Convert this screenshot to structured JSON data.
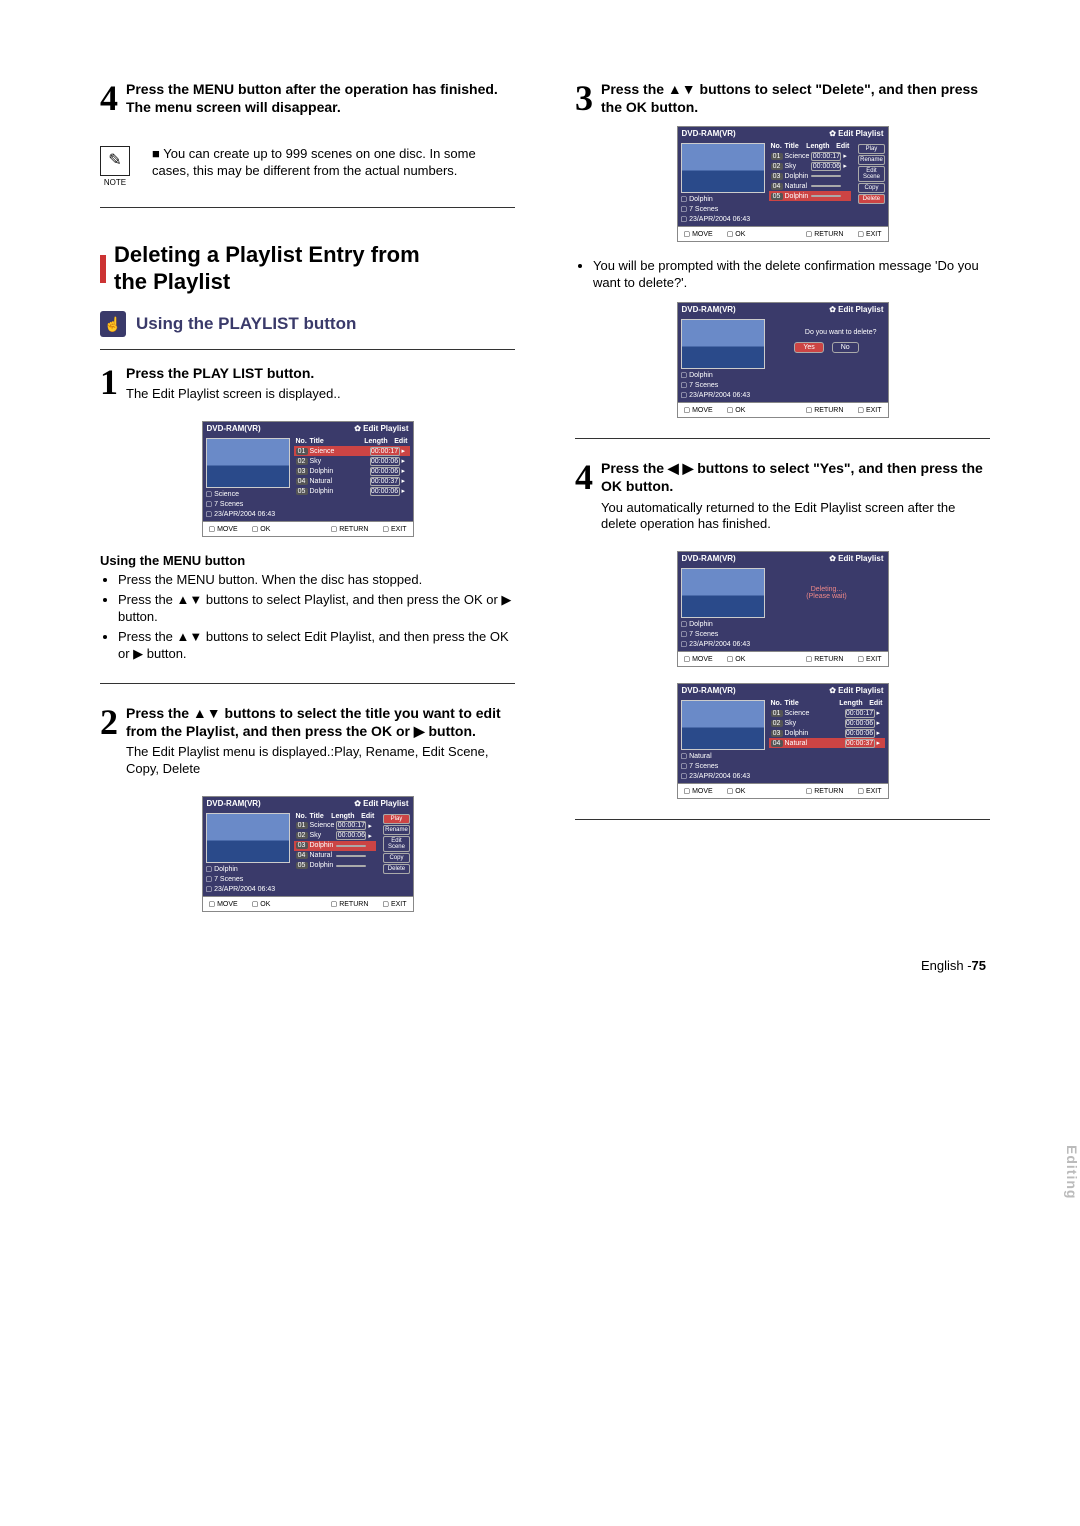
{
  "left": {
    "step4": {
      "num": "4",
      "text_a": "Press the MENU button after the operation has finished.",
      "text_b": "The menu screen will disappear."
    },
    "note": {
      "label": "NOTE",
      "bullet": "■",
      "text": "You can create up to 999 scenes on one disc. In some cases, this may be different from the actual numbers."
    },
    "h2_a": "Deleting a Playlist Entry from",
    "h2_b": "the Playlist",
    "sub_title": "Using the PLAYLIST button",
    "step1": {
      "num": "1",
      "title": "Press the PLAY LIST button.",
      "body": "The Edit Playlist screen is displayed.."
    },
    "menu_head": "Using the MENU button",
    "menu_b1": "Press the MENU button. When the disc has stopped.",
    "menu_b2": "Press the ▲▼ buttons to select Playlist, and then press the OK or ▶ button.",
    "menu_b3": "Press the ▲▼ buttons to select Edit Playlist, and then press the OK or ▶ button.",
    "step2": {
      "num": "2",
      "text": "Press the ▲▼ buttons to select the title you want to edit from the Playlist, and then press the OK or ▶ button.",
      "body": "The Edit Playlist menu is displayed.:Play, Rename, Edit Scene, Copy, Delete"
    }
  },
  "right": {
    "step3": {
      "num": "3",
      "text": "Press the ▲▼ buttons to select \"Delete\", and then press the OK button."
    },
    "confirm_body": "You will be prompted with the delete confirmation message 'Do you want to delete?'.",
    "step4r": {
      "num": "4",
      "text": "Press the ◀ ▶ buttons to select \"Yes\", and then press the OK button.",
      "body": "You automatically returned to the Edit Playlist screen after the delete operation has finished."
    }
  },
  "scr": {
    "disc": "DVD-RAM(VR)",
    "panel_label": "Edit Playlist",
    "no": "No.",
    "title": "Title",
    "length": "Length",
    "edit": "Edit",
    "titles_a": [
      "Science",
      "Sky",
      "Dolphin",
      "Natural",
      "Dolphin"
    ],
    "titles_b": [
      "Science",
      "Sky",
      "Dolphin",
      "Natural",
      "Dolphin"
    ],
    "titles_c": [
      "Science",
      "Sky",
      "Dolphin",
      "Natural"
    ],
    "lens_a": [
      "00:00:17",
      "00:00:06",
      "00:00:06",
      "00:00:37",
      "00:00:06"
    ],
    "lens_b": [
      "00:00:17",
      "00:00:06",
      "00:00:06",
      "00:00:37"
    ],
    "edit_menu": [
      "Play",
      "Rename",
      "Edit Scene",
      "Copy",
      "Delete"
    ],
    "info_title_a": "Science",
    "info_title_b": "Dolphin",
    "info_title_c": "Natural",
    "info_scenes": "7 Scenes",
    "info_date": "23/APR/2004 06:43",
    "move": "MOVE",
    "ok": "OK",
    "return": "RETURN",
    "exit": "EXIT",
    "dlg_msg": "Do you want to delete?",
    "yes": "Yes",
    "no_btn": "No",
    "deleting_a": "Deleting...",
    "deleting_b": "(Please wait)"
  },
  "sidebar": "Editing",
  "footer_a": "English -",
  "footer_b": "75"
}
